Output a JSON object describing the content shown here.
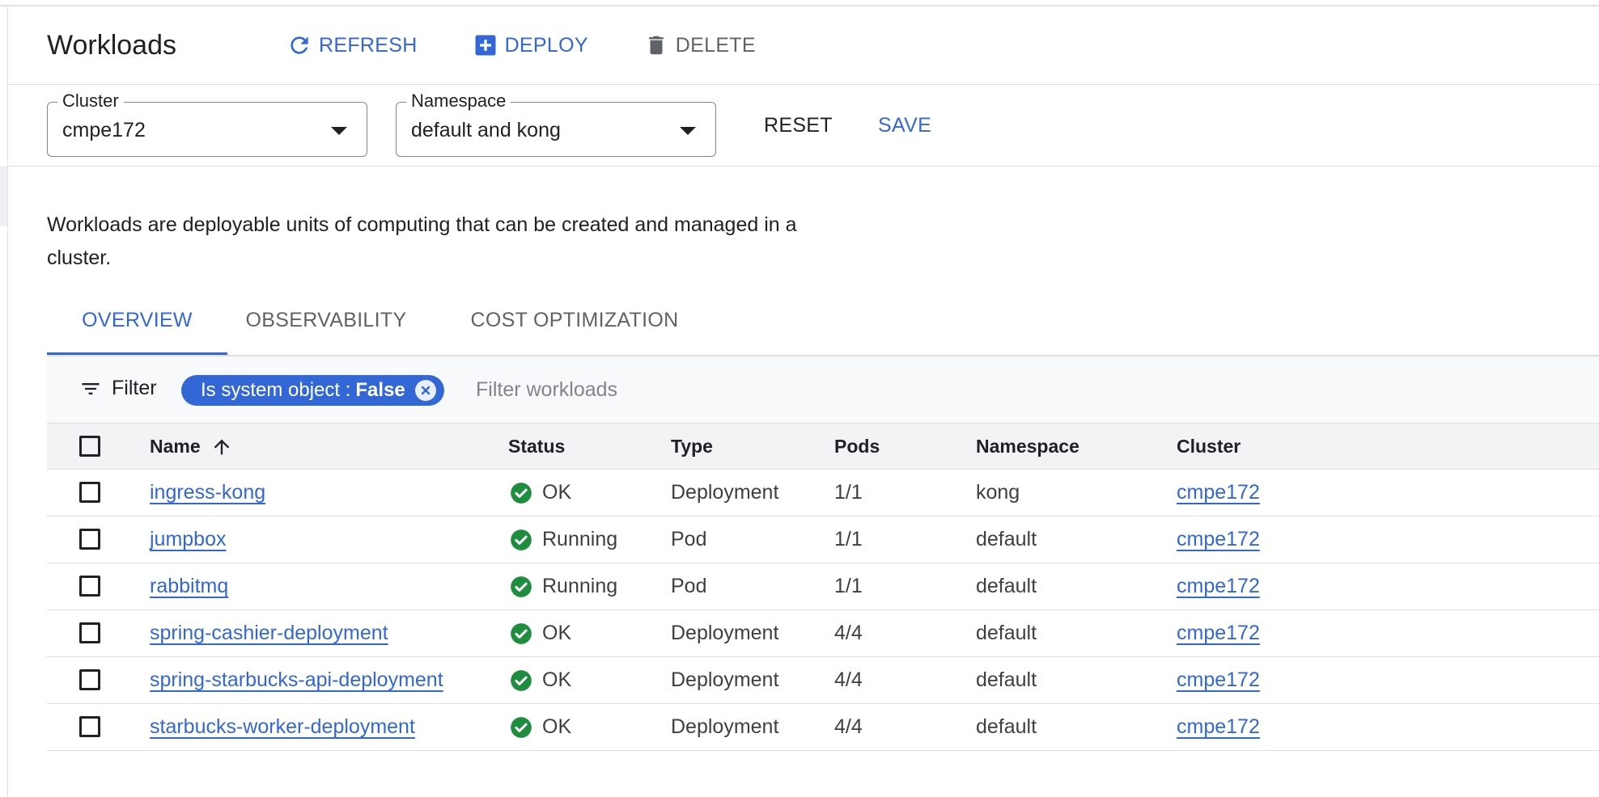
{
  "header": {
    "title": "Workloads",
    "refresh_label": "REFRESH",
    "deploy_label": "DEPLOY",
    "delete_label": "DELETE"
  },
  "selectors": {
    "cluster": {
      "label": "Cluster",
      "value": "cmpe172"
    },
    "namespace": {
      "label": "Namespace",
      "value": "default and kong"
    },
    "reset_label": "RESET",
    "save_label": "SAVE"
  },
  "description": "Workloads are deployable units of computing that can be created and managed in a cluster.",
  "tabs": [
    {
      "label": "OVERVIEW",
      "active": true
    },
    {
      "label": "OBSERVABILITY",
      "active": false
    },
    {
      "label": "COST OPTIMIZATION",
      "active": false
    }
  ],
  "filter": {
    "label": "Filter",
    "chip": {
      "key": "Is system object :",
      "value": "False"
    },
    "placeholder": "Filter workloads"
  },
  "table": {
    "columns": [
      "Name",
      "Status",
      "Type",
      "Pods",
      "Namespace",
      "Cluster"
    ],
    "rows": [
      {
        "name": "ingress-kong",
        "status": "OK",
        "type": "Deployment",
        "pods": "1/1",
        "namespace": "kong",
        "cluster": "cmpe172"
      },
      {
        "name": "jumpbox",
        "status": "Running",
        "type": "Pod",
        "pods": "1/1",
        "namespace": "default",
        "cluster": "cmpe172"
      },
      {
        "name": "rabbitmq",
        "status": "Running",
        "type": "Pod",
        "pods": "1/1",
        "namespace": "default",
        "cluster": "cmpe172"
      },
      {
        "name": "spring-cashier-deployment",
        "status": "OK",
        "type": "Deployment",
        "pods": "4/4",
        "namespace": "default",
        "cluster": "cmpe172"
      },
      {
        "name": "spring-starbucks-api-deployment",
        "status": "OK",
        "type": "Deployment",
        "pods": "4/4",
        "namespace": "default",
        "cluster": "cmpe172"
      },
      {
        "name": "starbucks-worker-deployment",
        "status": "OK",
        "type": "Deployment",
        "pods": "4/4",
        "namespace": "default",
        "cluster": "cmpe172"
      }
    ]
  },
  "colors": {
    "accent": "#3367d6",
    "status_ok": "#1e8e3e",
    "muted": "#5f6368"
  },
  "icons": [
    "refresh-icon",
    "add-box-icon",
    "trash-icon",
    "filter-list-icon",
    "chip-close-icon",
    "sort-ascending-icon",
    "check-circle-icon",
    "dropdown-caret-icon"
  ]
}
